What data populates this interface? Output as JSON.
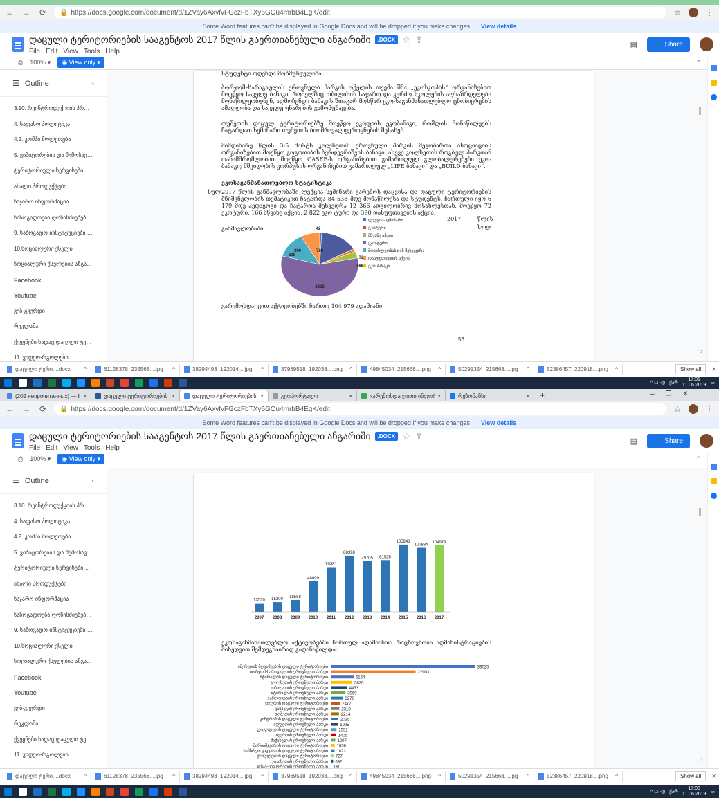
{
  "browser": {
    "url": "https://docs.google.com/document/d/1ZVay6AxvfvFGczFbTXy6GOu4mrbB4EgK/edit",
    "url2": "https://docs.google.com/document/d/1ZVay6AxvfvFGczFbTXy6GOu4mrbB4EgK/edit",
    "tabs": [
      {
        "label": "(202 непрочитанных) — lika_st",
        "color": "#4a86e8"
      },
      {
        "label": "დაცული ტერიტორიების სა",
        "color": "#2b579a"
      },
      {
        "label": "დაცული ტერიტორიების სა",
        "color": "#4285f4",
        "active": true
      },
      {
        "label": "გეოპორტალი",
        "color": "#999999"
      },
      {
        "label": "გარემოსდაცვითი ინფორმაც",
        "color": "#34a853"
      },
      {
        "label": "რეზონანსი",
        "color": "#1877f2"
      }
    ],
    "new_tab": "+"
  },
  "notice": {
    "text": "Some Word features can't be displayed in Google Docs and will be dropped if you make changes",
    "link": "View details"
  },
  "doc": {
    "title": "დაცული ტერიტორიების სააგენტოს 2017 წლის გაერთიანებული ანგარიში",
    "badge": ".DOCX",
    "menu": [
      "File",
      "Edit",
      "View",
      "Tools",
      "Help"
    ],
    "zoom": "100%",
    "mode": "View only",
    "share": "Share"
  },
  "outline": {
    "title": "Outline",
    "items": [
      "3.10. რეინტროდუქციის პროგრამები დაცული ტ...",
      "4. საფასო პოლიტიკა",
      "4.2. კომპი მოლეთება",
      "5. ვიზიტორების და შემოსავლების ...",
      "ტერიტორიული სერვისებიდან მიღებ...",
      "ახალი პროდუქტები",
      "საჯარო ინფორმაცია",
      "საზოგადოება ღონისძიებები და საინფ...",
      "9. საზოგადო ინსტიტუციები და მა...",
      "10.სოციალური ქსელი",
      "სოციალური ქსელების ანგარიში - ი...",
      "Facebook",
      "Youtube",
      "ვებ-გვერდი",
      "რეკლამა",
      "ქვეყნები სადაც დაცული ტერიტორ...",
      "11. ვიდეო-რგოლები"
    ]
  },
  "page1": {
    "p0": "სტუდენტი ოდენდა მოხმუხეულიბა.",
    "p1": "ბორჯომ–ხარაგაულის ეროვნული პარკის ოქელის თეემა შმა „ეკოსკოპის“ ორგანიზებით მოეწყო საველე ბანაკი, რომელშიც თბილისის საჯარო და კერძო სკოლების აღსაზრდელები მონაწილეობდნენ, აღმოჩენდი ბანაკის შთაგარ მოსწარ ეკო-საგანმანათლებლო ცნობიერების ამაღლება და საველე უნარების გამომუშავება.",
    "p2": "თუშეთის დაცულ ტერიტორიებზე მოეწყო ეკოფიის ეკობანაკი, რომლის მონაწილეებს ჩატარდათ სემინარი თუშეთის ბიომრავალფეროვნების შესახებ.",
    "p3": "მიმდინარე წლის 3-5 მარტს კოლხეთის ეროვნული პარკის მეგობართა ასოციაციის ორგანიზებით მოეწყო გოგოთაბის ბერდევრიშვის ბანაკი. ასევე კოლხეთის როგბულ პარკთან თანამშრომლობით მოეწყო CASEE-ს ორგანიზებით გამართლულ გლობალურებები ეკო-ბანაკი; მშვიდობის კორპუსის ორგანიზებით გამართლულ „LIFE ბანაკი“ და „BUILD ბანაკი“.",
    "heading": "ეკოსაგანმანათლებლო სტატისტიკა",
    "p4": "2017 წლის განმავლობაში ლექცია–სემინარი გარემოს დაცვისა და დაცული ტერიტორიების მნიშვნელობის თემატიკით ჩატარდა 84 538–მდე მონაწილესა და სტუდენტს, ჩართული იყო 6 179–მდე პედაგოგი და ჩატარდა მეხვედრა 12 366 ადგილობრივ მოსახლესთან. მოეწყო 72 ეკოტური, 166 მწვანე აქცია, 2 822 ეკო ტური და 390 დასუფთავების აქცია.",
    "side_label_left": "სულ",
    "inline_year": "2017",
    "inline_word": "წლის",
    "inline_left": "განმავლობაში",
    "inline_right": "სულ",
    "p5": "გარემოსდაცვით აქტივობებში ჩართო 104 979 ადამიანი.",
    "page_number": "56"
  },
  "pie_chart_data": {
    "type": "pie",
    "values": [
      42,
      788,
      72,
      166,
      2822,
      629,
      390
    ],
    "labels": [
      "42",
      "788",
      "72",
      "166",
      "2822",
      "629",
      "390"
    ],
    "colors": [
      "#4472c4",
      "#4d5b9e",
      "#ed7d31",
      "#a5c244",
      "#8064a2",
      "#4bacc6",
      "#f79646"
    ],
    "legend": [
      "ლექცია-სემინარი",
      "ეკოტური",
      "მწვანე აქცია",
      "ეკო-ტური",
      "მოსახლეობასთან შეხვედრა",
      "დასუფთავების აქცია",
      "ეკო-ბანაკი"
    ],
    "legend_colors": [
      "#4472c4",
      "#c0504d",
      "#9bbb59",
      "#8064a2",
      "#4bacc6",
      "#f79646",
      "#ffc000"
    ]
  },
  "chart_data": [
    {
      "type": "bar",
      "categories": [
        "2007",
        "2008",
        "2009",
        "2010",
        "2011",
        "2012",
        "2013",
        "2014",
        "2015",
        "2016",
        "2017"
      ],
      "values": [
        13520,
        15200,
        18588,
        48099,
        70381,
        88398,
        79705,
        81526,
        105948,
        100884,
        104979
      ],
      "colors": [
        "#2e75b6",
        "#2e75b6",
        "#2e75b6",
        "#2e75b6",
        "#2e75b6",
        "#2e75b6",
        "#2e75b6",
        "#2e75b6",
        "#2e75b6",
        "#2e75b6",
        "#92d050"
      ],
      "ylim": [
        0,
        120000
      ]
    },
    {
      "type": "bar",
      "orientation": "horizontal",
      "categories": [
        "იმერეთის მღვიმეების დაცული ტერიტორიები",
        "ბორჯომ-ხარაგაულის ეროვნული პარკი",
        "მტირალას დაცული ტერიტორიები",
        "კოლხეთის ეროვნული პარკი",
        "თბილისის ეროვნული პარკი",
        "მტირალას ეროვნული პარკი",
        "ვაშლოვანის ეროვნული პარკი",
        "ჭიქურის დაცული ტერიტორიები",
        "ყაზბეგის ეროვნული პარკი",
        "თუშეთის ეროვნული პარკი",
        "კინტრიშის დაცული ტერიტორიები",
        "ალგეთის ეროვნული პარკი",
        "ლაგოდეხის დაცული ტერიტორიები",
        "ივერიის ეროვნული პარკი",
        "მაჭახელას ეროვნული პარკი",
        "მარიამჯვარის დაცული ტერიტორიები",
        "სამხრეთ კავკასიის დაცული ტერიტორიები",
        "ქობულეთის დაცული ტერიტორიები",
        "ჯავახეთის ეროვნული პარკი",
        "ფშავ-ხევსურეთის ეროვნული პარკი"
      ],
      "values": [
        39025,
        22903,
        6164,
        5820,
        4433,
        3969,
        3270,
        2477,
        2310,
        2214,
        2035,
        1925,
        1552,
        1405,
        1207,
        1036,
        1022,
        727,
        632,
        180
      ],
      "colors": [
        "#4472c4",
        "#ed7d31",
        "#4472c4",
        "#ffc000",
        "#264478",
        "#70ad47",
        "#2e75b6",
        "#c55a11",
        "#7f7f7f",
        "#997300",
        "#2e75b6",
        "#264478",
        "#5b9bd5",
        "#c00000",
        "#70ad47",
        "#ffc000",
        "#4472c4",
        "#a9d18e",
        "#264478",
        "#7f7f7f"
      ],
      "xlim": [
        0,
        40000
      ]
    }
  ],
  "page2": {
    "caption": "ეკოსაგანმანათლებლო აქტივობებში ჩართულ ადამიანთა რიცხოვნობა ადმინისტრაციების მიხედვით შემდეგნაირად გადანაწილდა:"
  },
  "downloads": {
    "items": [
      "დაცული ტერი....docx",
      "61128378_235568....jpg",
      "38294493_192014....jpg",
      "37969518_192038....png",
      "49845034_215668....png",
      "50291354_215668....jpg",
      "52386457_220918....png"
    ],
    "show_all": "Show all"
  },
  "taskbar": {
    "lang": "ქარ",
    "time": "17:01",
    "date": "11.06.2019",
    "time2": "17:03",
    "date2": "11.06.2019",
    "apps": [
      "#0078d7",
      "#ffffff",
      "#1e6fc1",
      "#217346",
      "#00aff0",
      "#1e90ff",
      "#ff7f00",
      "#d04423",
      "#ea4335",
      "#0f9d58",
      "#1a73e8",
      "#d83b01",
      "#2a5699"
    ]
  }
}
